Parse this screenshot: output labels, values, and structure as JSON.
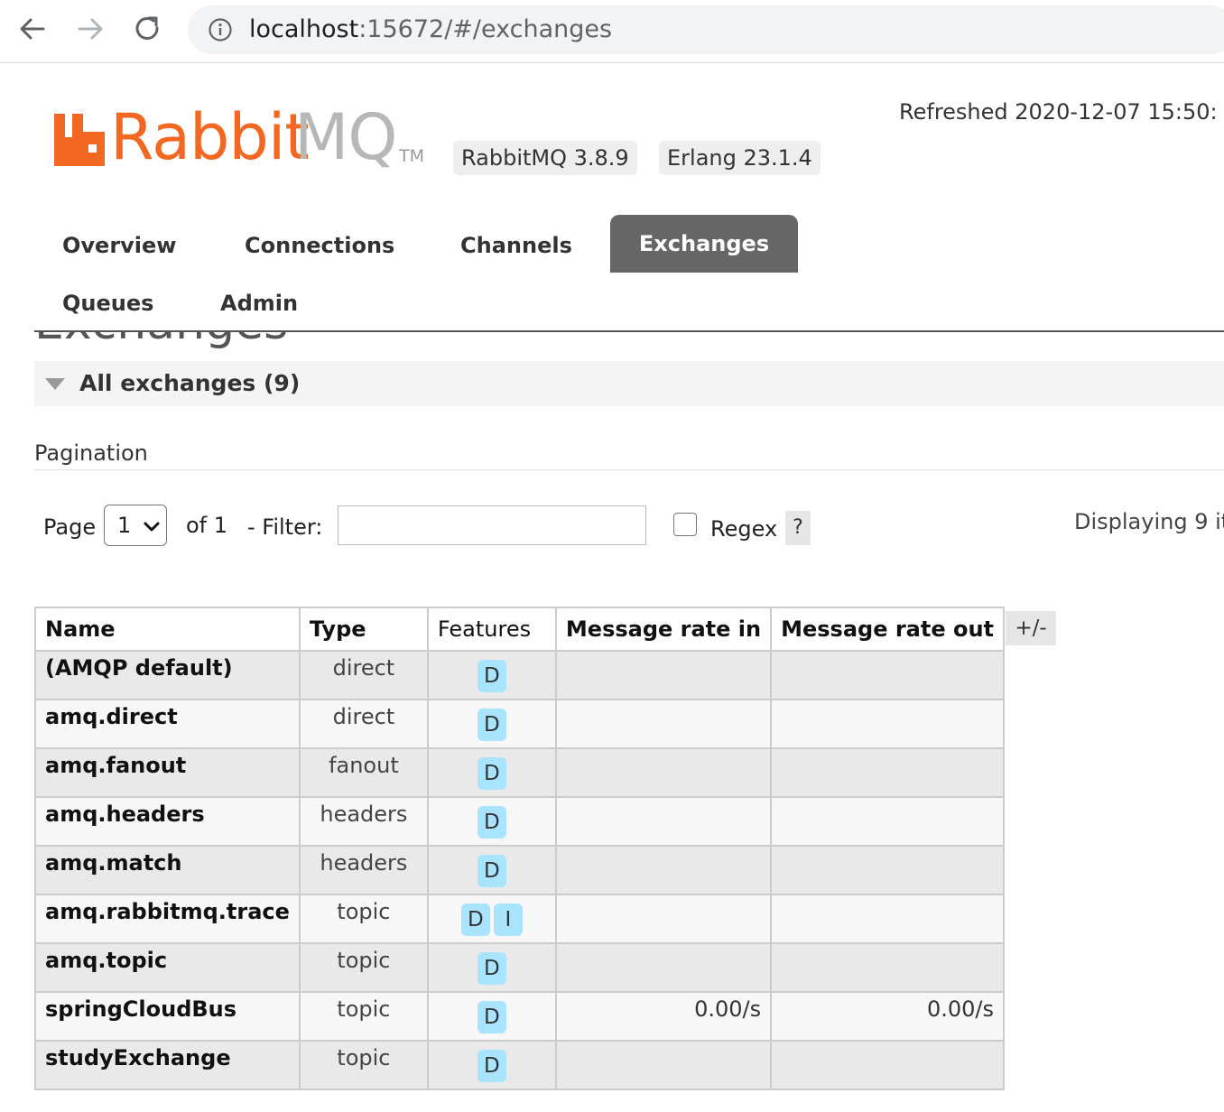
{
  "browser": {
    "url_host": "localhost",
    "url_path": ":15672/#/exchanges"
  },
  "header": {
    "logo_rabbit": "Rabbit",
    "logo_mq": "MQ",
    "logo_tm": "TM",
    "rabbitmq_version": "RabbitMQ 3.8.9",
    "erlang_version": "Erlang 23.1.4",
    "refreshed": "Refreshed 2020-12-07 15:50:"
  },
  "tabs": [
    {
      "label": "Overview"
    },
    {
      "label": "Connections"
    },
    {
      "label": "Channels"
    },
    {
      "label": "Exchanges",
      "active": true
    },
    {
      "label": "Queues"
    },
    {
      "label": "Admin"
    }
  ],
  "page_heading": "Exchanges",
  "section": {
    "title": "All exchanges (9)"
  },
  "pagination": {
    "label": "Pagination",
    "page_label": "Page",
    "page_selected": "1",
    "of_label": "of 1",
    "filter_label": "- Filter:",
    "filter_value": "",
    "regex_label": "Regex",
    "regex_checked": false,
    "help_label": "?",
    "displaying": "Displaying 9 it"
  },
  "table": {
    "columns": [
      "Name",
      "Type",
      "Features",
      "Message rate in",
      "Message rate out"
    ],
    "toggle_label": "+/-",
    "rows": [
      {
        "name": "(AMQP default)",
        "type": "direct",
        "features": [
          "D"
        ],
        "rate_in": "",
        "rate_out": ""
      },
      {
        "name": "amq.direct",
        "type": "direct",
        "features": [
          "D"
        ],
        "rate_in": "",
        "rate_out": ""
      },
      {
        "name": "amq.fanout",
        "type": "fanout",
        "features": [
          "D"
        ],
        "rate_in": "",
        "rate_out": ""
      },
      {
        "name": "amq.headers",
        "type": "headers",
        "features": [
          "D"
        ],
        "rate_in": "",
        "rate_out": ""
      },
      {
        "name": "amq.match",
        "type": "headers",
        "features": [
          "D"
        ],
        "rate_in": "",
        "rate_out": ""
      },
      {
        "name": "amq.rabbitmq.trace",
        "type": "topic",
        "features": [
          "D",
          "I"
        ],
        "rate_in": "",
        "rate_out": ""
      },
      {
        "name": "amq.topic",
        "type": "topic",
        "features": [
          "D"
        ],
        "rate_in": "",
        "rate_out": ""
      },
      {
        "name": "springCloudBus",
        "type": "topic",
        "features": [
          "D"
        ],
        "rate_in": "0.00/s",
        "rate_out": "0.00/s"
      },
      {
        "name": "studyExchange",
        "type": "topic",
        "features": [
          "D"
        ],
        "rate_in": "",
        "rate_out": ""
      }
    ]
  },
  "colors": {
    "brand_orange": "#f26822",
    "active_tab": "#666666",
    "feature_badge": "#a8e4ff"
  }
}
